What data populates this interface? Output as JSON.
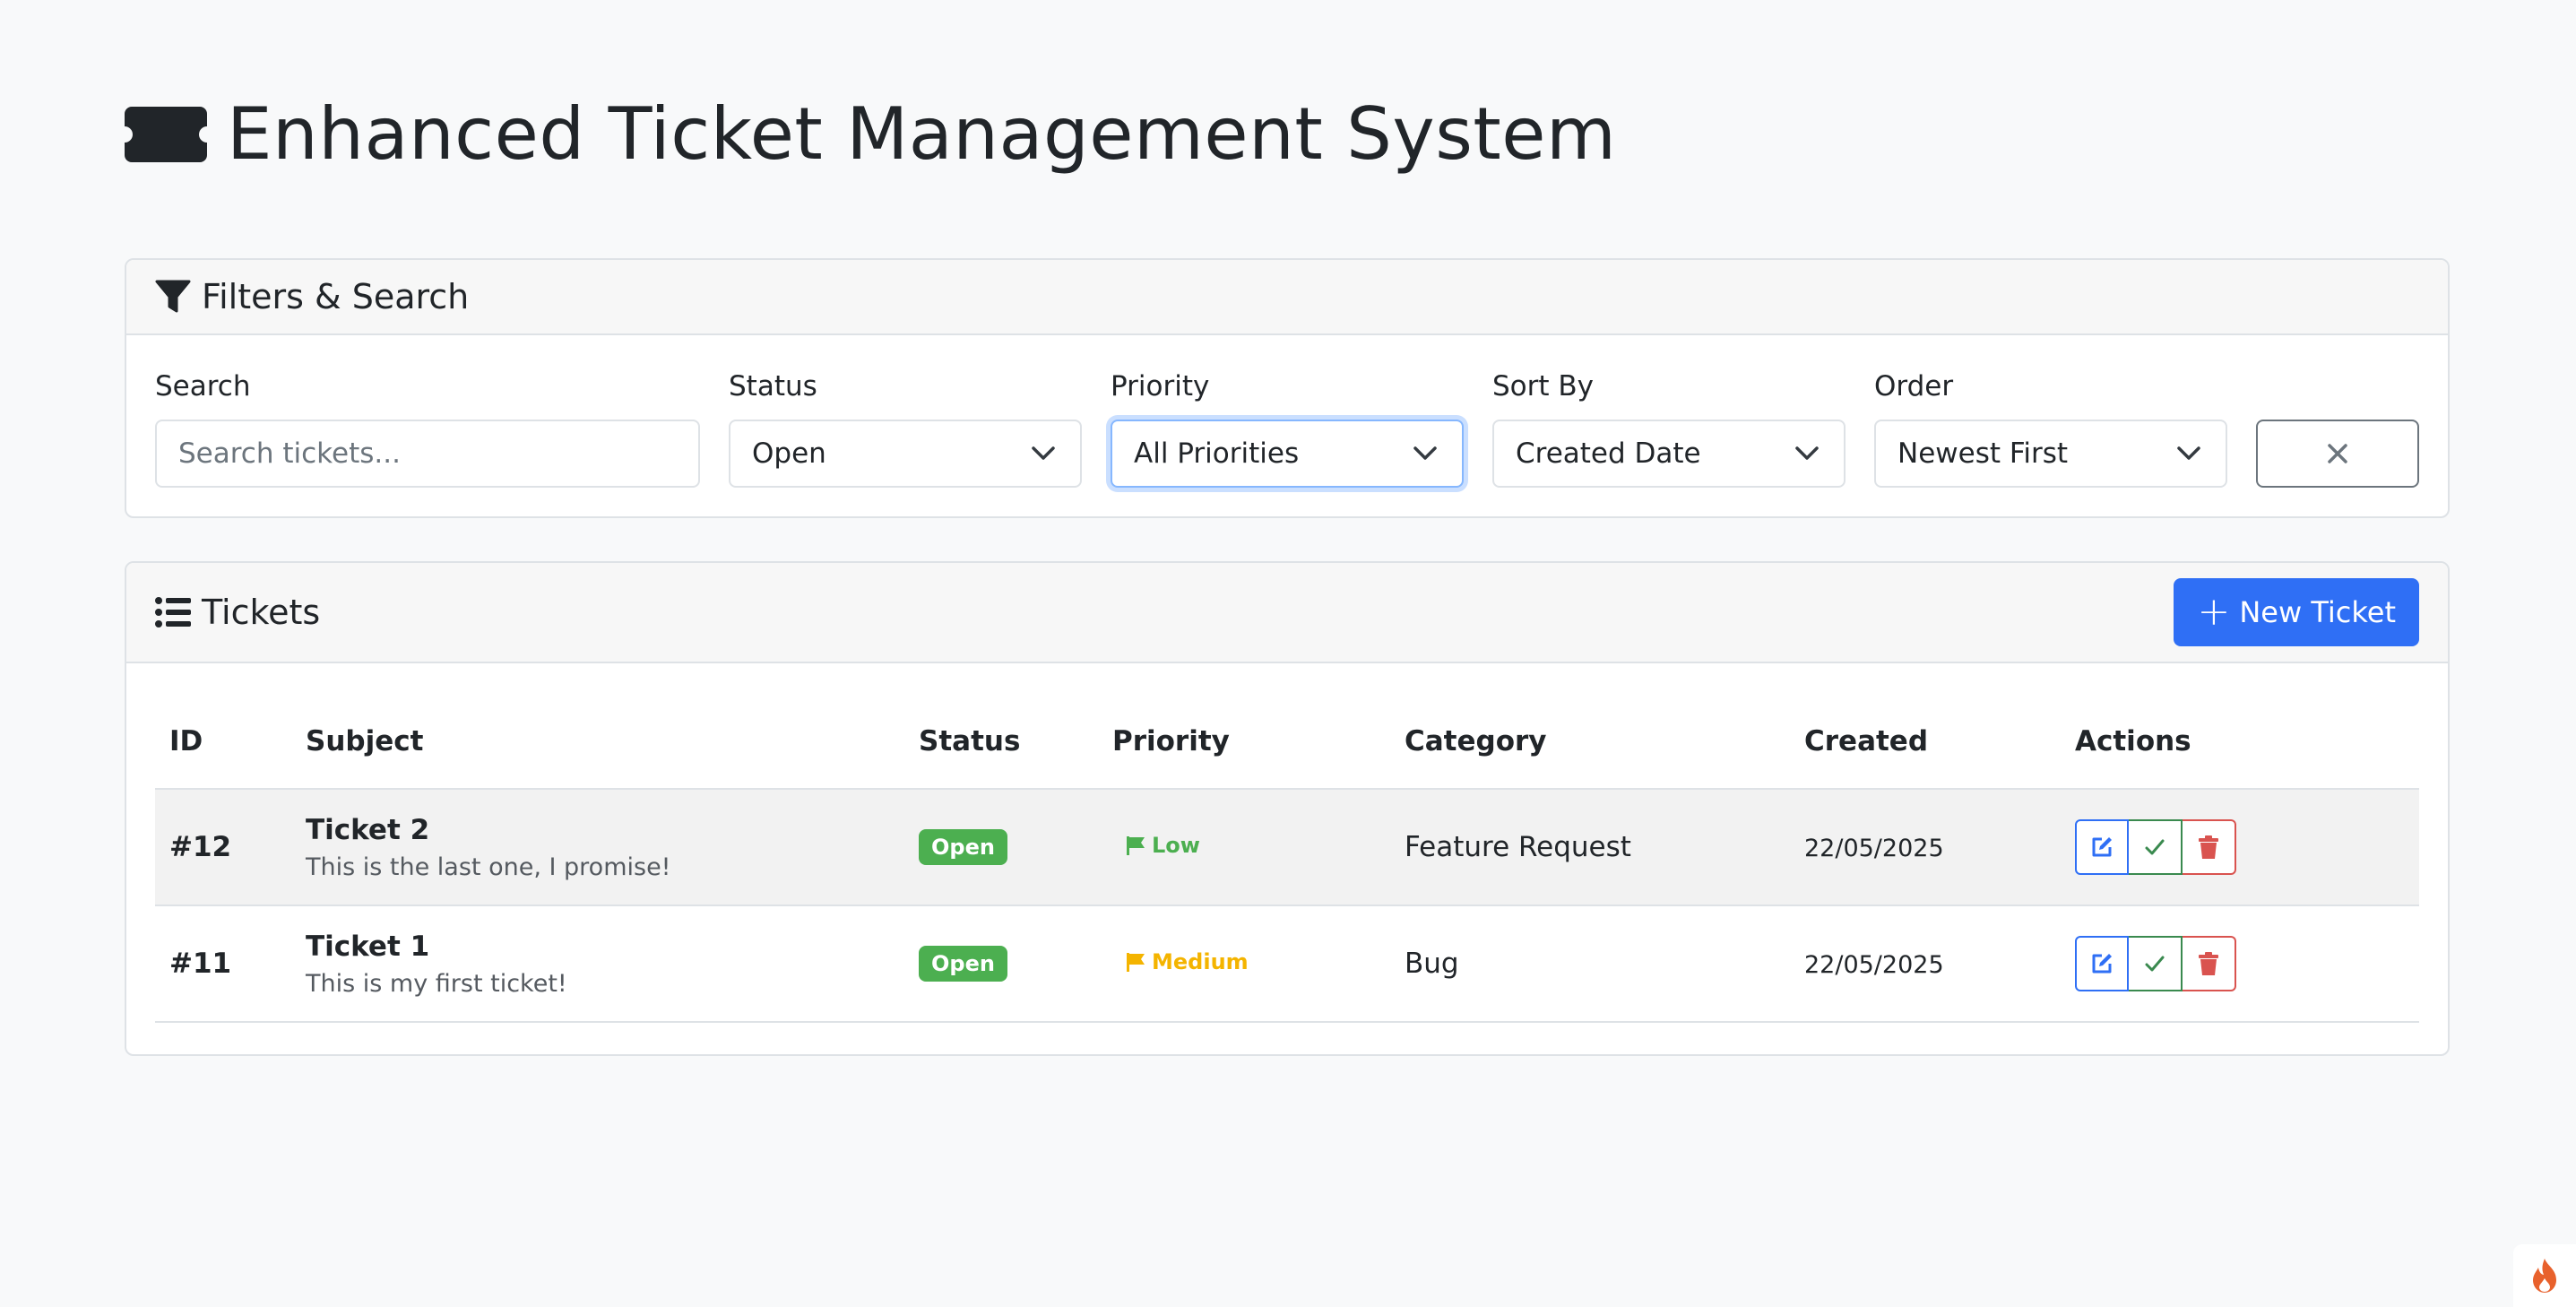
{
  "header": {
    "title": "Enhanced Ticket Management System",
    "icon": "ticket-icon"
  },
  "filters": {
    "title": "Filters & Search",
    "search": {
      "label": "Search",
      "placeholder": "Search tickets...",
      "value": ""
    },
    "status": {
      "label": "Status",
      "value": "Open"
    },
    "priority": {
      "label": "Priority",
      "value": "All Priorities"
    },
    "sort_by": {
      "label": "Sort By",
      "value": "Created Date"
    },
    "order": {
      "label": "Order",
      "value": "Newest First"
    },
    "clear_icon": "close-icon"
  },
  "tickets": {
    "title": "Tickets",
    "new_button": "New Ticket",
    "columns": [
      "ID",
      "Subject",
      "Status",
      "Priority",
      "Category",
      "Created",
      "Actions"
    ],
    "rows": [
      {
        "id": "#12",
        "subject": "Ticket 2",
        "description": "This is the last one, I promise!",
        "status": "Open",
        "priority": "Low",
        "priority_color": "#4caf50",
        "category": "Feature Request",
        "created": "22/05/2025"
      },
      {
        "id": "#11",
        "subject": "Ticket 1",
        "description": "This is my first ticket!",
        "status": "Open",
        "priority": "Medium",
        "priority_color": "#f4b400",
        "category": "Bug",
        "created": "22/05/2025"
      }
    ]
  },
  "colors": {
    "primary": "#2f6ff5",
    "success": "#4caf50",
    "danger": "#d9534f",
    "warning": "#f4b400"
  }
}
